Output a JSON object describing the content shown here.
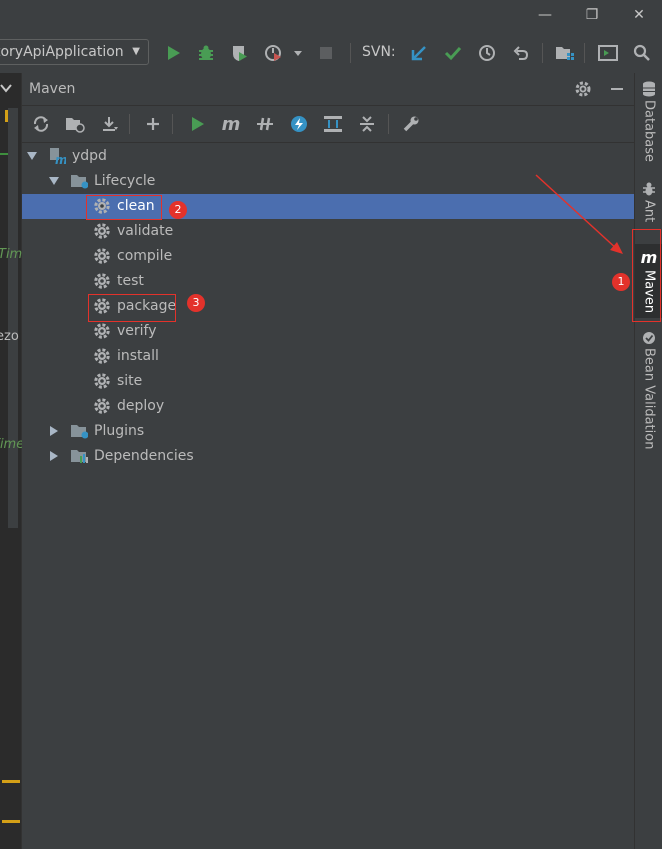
{
  "window": {
    "minimize_glyph": "—",
    "restore_glyph": "❐",
    "close_glyph": "✕"
  },
  "toolbar": {
    "run_config": "toryApiApplication",
    "svn_label": "SVN:"
  },
  "editor_fragments": [
    "Tim",
    "ezo",
    "Time"
  ],
  "panel": {
    "title": "Maven"
  },
  "tree": {
    "root": "ydpd",
    "lifecycle": "Lifecycle",
    "goals": [
      "clean",
      "validate",
      "compile",
      "test",
      "package",
      "verify",
      "install",
      "site",
      "deploy"
    ],
    "plugins": "Plugins",
    "dependencies": "Dependencies",
    "selected": "clean"
  },
  "right_tabs": [
    "Database",
    "Ant",
    "Maven",
    "Bean Validation"
  ],
  "annotations": {
    "badges": [
      "1",
      "2",
      "3"
    ]
  },
  "colors": {
    "background": "#3c3f41",
    "selection": "#4b6eaf",
    "run_green": "#499c54",
    "annotation_red": "#e3322b",
    "svn_blue": "#3592c4"
  }
}
